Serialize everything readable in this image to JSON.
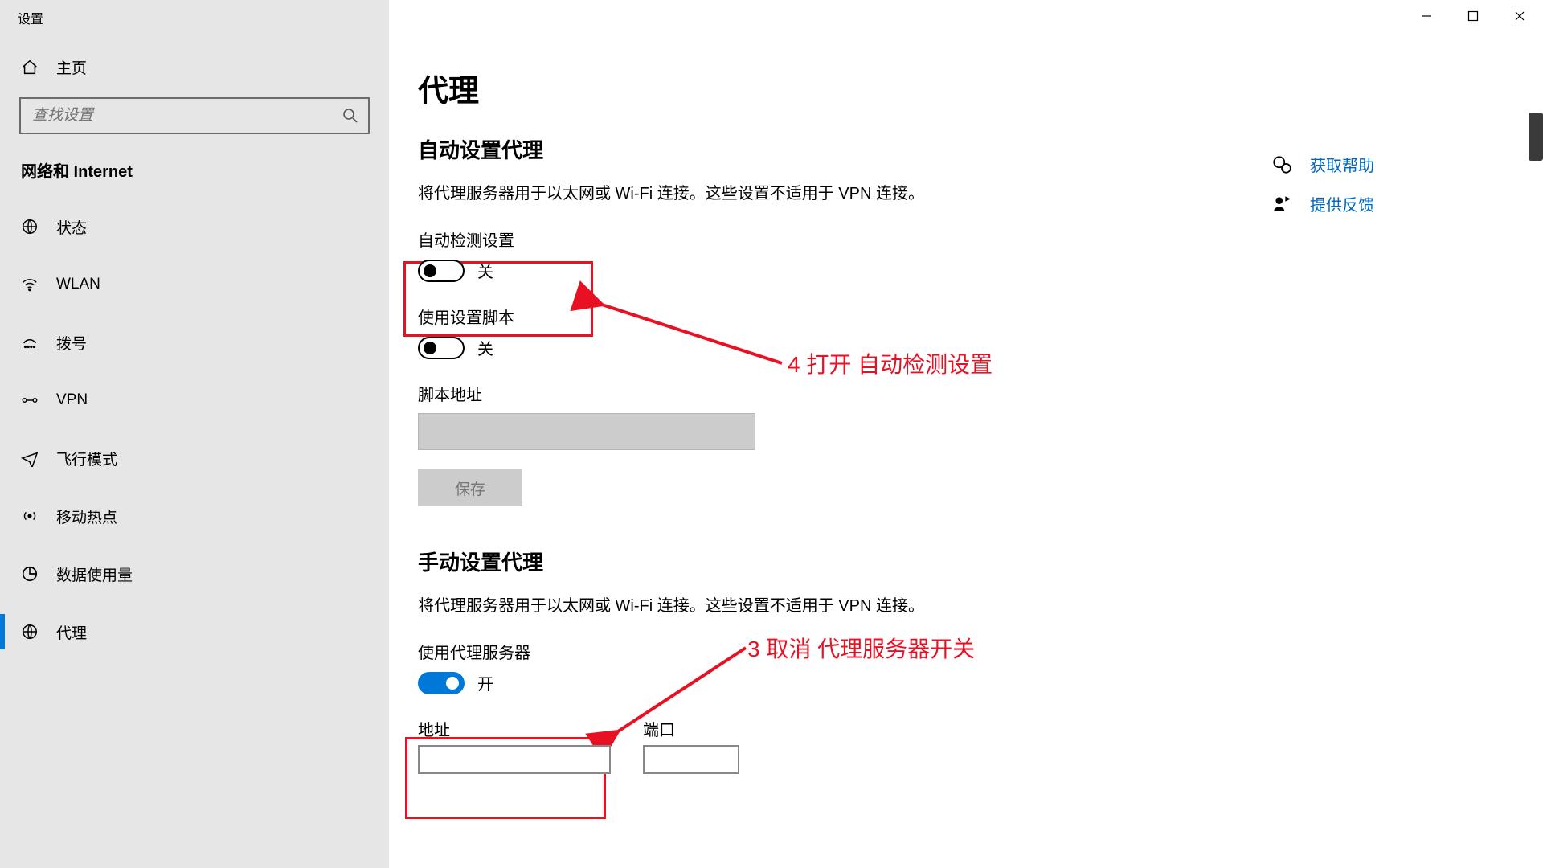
{
  "window": {
    "title": "设置"
  },
  "sidebar": {
    "home": "主页",
    "search_placeholder": "查找设置",
    "category": "网络和 Internet",
    "items": [
      {
        "label": "状态"
      },
      {
        "label": "WLAN"
      },
      {
        "label": "拨号"
      },
      {
        "label": "VPN"
      },
      {
        "label": "飞行模式"
      },
      {
        "label": "移动热点"
      },
      {
        "label": "数据使用量"
      },
      {
        "label": "代理"
      }
    ]
  },
  "main": {
    "title": "代理",
    "auto": {
      "heading": "自动设置代理",
      "desc": "将代理服务器用于以太网或 Wi-Fi 连接。这些设置不适用于 VPN 连接。",
      "auto_detect_label": "自动检测设置",
      "auto_detect_state": "关",
      "use_script_label": "使用设置脚本",
      "use_script_state": "关",
      "script_addr_label": "脚本地址",
      "save": "保存"
    },
    "manual": {
      "heading": "手动设置代理",
      "desc": "将代理服务器用于以太网或 Wi-Fi 连接。这些设置不适用于 VPN 连接。",
      "use_proxy_label": "使用代理服务器",
      "use_proxy_state": "开",
      "addr_label": "地址",
      "port_label": "端口"
    }
  },
  "right": {
    "help": "获取帮助",
    "feedback": "提供反馈"
  },
  "annotations": {
    "step4": "4 打开 自动检测设置",
    "step3": "3 取消 代理服务器开关"
  }
}
